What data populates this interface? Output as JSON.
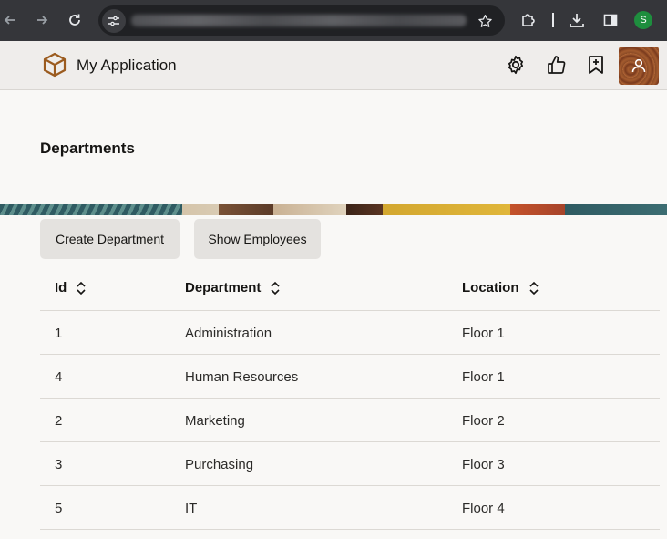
{
  "browser": {
    "profile_initial": "S",
    "profile_color": "#1e8e3e"
  },
  "app": {
    "title": "My Application",
    "accent": "#9b5b1f"
  },
  "page": {
    "title": "Departments"
  },
  "actions": {
    "create_label": "Create Department",
    "employees_label": "Show Employees"
  },
  "table": {
    "headers": [
      "Id",
      "Department",
      "Location"
    ],
    "rows": [
      [
        "1",
        "Administration",
        "Floor 1"
      ],
      [
        "4",
        "Human Resources",
        "Floor 1"
      ],
      [
        "2",
        "Marketing",
        "Floor 2"
      ],
      [
        "3",
        "Purchasing",
        "Floor 3"
      ],
      [
        "5",
        "IT",
        "Floor 4"
      ]
    ]
  },
  "icons": {
    "back": "arrow-left-icon",
    "forward": "arrow-right-icon",
    "reload": "reload-icon",
    "site_info": "tune-icon",
    "bookmark_star": "star-icon",
    "extensions": "puzzle-icon",
    "downloads": "download-icon",
    "side_panel": "side-panel-icon",
    "settings": "gear-icon",
    "like": "thumbs-up-icon",
    "bookmark": "bookmark-plus-icon",
    "user": "user-icon",
    "sort": "sort-icon"
  }
}
